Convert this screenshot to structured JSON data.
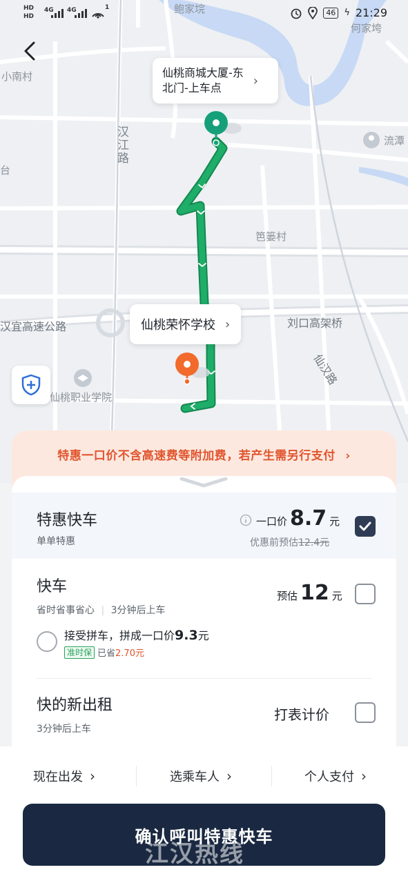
{
  "status_bar": {
    "left_hd1": "HD",
    "left_hd2": "HD",
    "net1": "4G",
    "net2": "4G",
    "wifi_level": "1",
    "battery": "46",
    "time": "21:29"
  },
  "map": {
    "labels": {
      "bao_jia_yuan": "鲍家垸",
      "he_jia_wan": "何家垮",
      "xiao_nan_cun": "小南村",
      "han_jiang_lu": "汉江路",
      "liu_tan": "流潭",
      "tai": "台",
      "ba_wei_cun": "笆篓村",
      "han_yi_highway": "汉宜高速公路",
      "liu_kou_bridge": "刘口高架桥",
      "xian_han_lu": "仙汉路",
      "vocational_college": "仙桃职业学院"
    },
    "pickup_bubble": "仙桃商城大厦-东北门-上车点",
    "pickup_bubble_line1": "仙桃商城大厦-东",
    "pickup_bubble_line2": "北门-上车点",
    "destination_bubble": "仙桃荣怀学校",
    "route_color": "#1fad6a",
    "pickup_pin_color": "#16a07a",
    "dest_pin_color": "#f26a2c"
  },
  "notice": "特惠一口价不含高速费等附加费，若产生需另行支付",
  "rides": [
    {
      "title": "特惠快车",
      "subtitle": "单单特惠",
      "price_prefix": "一口价",
      "price": "8.7",
      "unit": "元",
      "original_label": "优惠前预估",
      "original_price": "12.4元",
      "checked": true
    },
    {
      "title": "快车",
      "subtitle_a": "省时省事省心",
      "subtitle_b": "3分钟后上车",
      "price_prefix": "预估",
      "price": "12",
      "unit": "元",
      "checked": false,
      "carpool": {
        "label": "接受拼车，拼成一口价",
        "price": "9.3",
        "unit": "元",
        "tag": "准时保",
        "saved_label": "已省",
        "saved": "2.70元"
      }
    },
    {
      "title": "快的新出租",
      "subtitle": "3分钟后上车",
      "price_text": "打表计价",
      "checked": false
    }
  ],
  "bottom_options": {
    "depart": "现在出发",
    "passenger": "选乘车人",
    "payment": "个人支付"
  },
  "confirm_button": "确认呼叫特惠快车",
  "watermark": "江汉热线"
}
